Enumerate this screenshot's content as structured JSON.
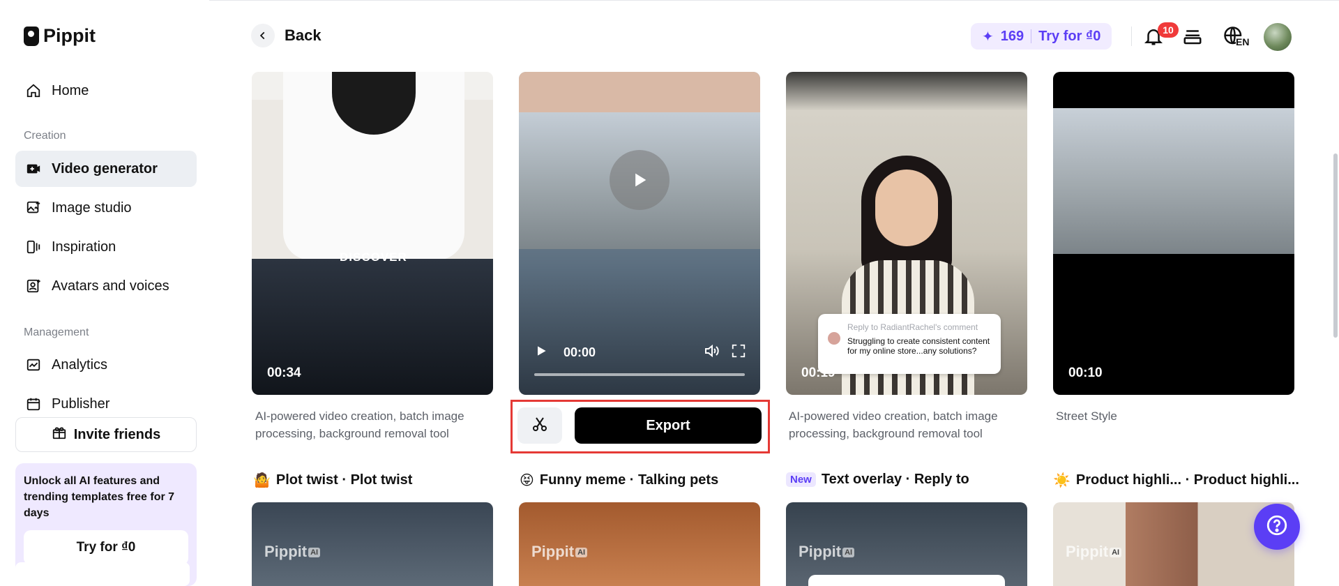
{
  "app": {
    "name": "Pippit"
  },
  "sidebar": {
    "home": "Home",
    "creation_label": "Creation",
    "creation_items": [
      {
        "label": "Video generator",
        "icon": "video-plus-icon",
        "active": true
      },
      {
        "label": "Image studio",
        "icon": "image-plus-icon",
        "active": false
      },
      {
        "label": "Inspiration",
        "icon": "inspiration-icon",
        "active": false
      },
      {
        "label": "Avatars and voices",
        "icon": "avatar-icon",
        "active": false
      }
    ],
    "management_label": "Management",
    "management_items": [
      {
        "label": "Analytics",
        "icon": "analytics-icon"
      },
      {
        "label": "Publisher",
        "icon": "calendar-icon"
      }
    ],
    "invite": "Invite friends",
    "promo": {
      "text": "Unlock all AI features and trending templates free for 7 days",
      "button": "Try for ₫0"
    }
  },
  "header": {
    "back": "Back",
    "credits": "169",
    "try_label": "Try for ₫0",
    "notifications": "10",
    "language": "EN",
    "accent": "#5b3ef5"
  },
  "cards": [
    {
      "duration": "00:34",
      "overlay_text": "DISCOVER",
      "description": "AI-powered video creation, batch image processing, background removal tool"
    },
    {
      "time": "00:00",
      "export_label": "Export"
    },
    {
      "duration": "00:19",
      "comment_reply": "Reply to RadiantRachel's comment",
      "comment_text": "Struggling to create consistent content for my online store...any solutions?",
      "description": "AI-powered video creation, batch image processing, background removal tool"
    },
    {
      "duration": "00:10",
      "description": "Street Style"
    }
  ],
  "templates": [
    {
      "emoji": "🤷",
      "title": "Plot twist · Plot twist"
    },
    {
      "emoji": "😝",
      "title": "Funny meme · Talking pets"
    },
    {
      "tag": "New",
      "title": "Text overlay · Reply to"
    },
    {
      "emoji": "☀️",
      "title": "Product highli... · Product highli..."
    }
  ],
  "watermark": {
    "brand": "Pippit",
    "suffix": "AI"
  }
}
